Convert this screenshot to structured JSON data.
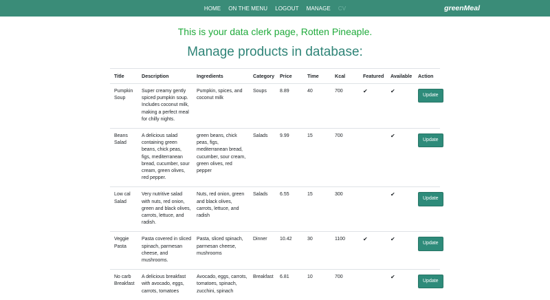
{
  "nav": {
    "items": [
      "HOME",
      "ON THE MENU",
      "LOGOUT",
      "MANAGE",
      "CV"
    ],
    "brand": "greenMeal"
  },
  "greeting": "This is your data clerk page, Rotten Pineaple.",
  "heading": "Manage products in database:",
  "table": {
    "columns": [
      "Title",
      "Description",
      "Ingredients",
      "Category",
      "Price",
      "Time",
      "Kcal",
      "Featured",
      "Available",
      "Action"
    ],
    "rows": [
      {
        "title": "Pumpkin Soup",
        "description": "Super creamy gently spiced pumpkin soup. Includes coconut milk, making a perfect meal for chilly nights.",
        "ingredients": "Pumpkin, spices, and coconut milk",
        "category": "Soups",
        "price": "8.89",
        "time": "40",
        "kcal": "700",
        "featured": "✔",
        "available": "✔",
        "action": "Update"
      },
      {
        "title": "Beans Salad",
        "description": "A delicious salad containing green beans, chick peas, figs, mediterranean bread, cucumber, sour cream, green olives, red pepper.",
        "ingredients": "green beans, chick peas, figs, mediterranean bread, cucumber, sour cream, green olives, red pepper",
        "category": "Salads",
        "price": "9.99",
        "time": "15",
        "kcal": "700",
        "featured": "",
        "available": "✔",
        "action": "Update"
      },
      {
        "title": "Low cal Salad",
        "description": "Very nutritive salad with nuts, red onion, green and black olives, carrots, lettuce, and radish.",
        "ingredients": "Nuts, red onion, green and black olives, carrots, lettuce, and radish",
        "category": "Salads",
        "price": "6.55",
        "time": "15",
        "kcal": "300",
        "featured": "",
        "available": "✔",
        "action": "Update"
      },
      {
        "title": "Veggie Pasta",
        "description": "Pasta covered in sliced spinach, parmesan cheese, and mushrooms.",
        "ingredients": "Pasta, sliced spinach, parmesan cheese, mushrooms",
        "category": "Dinner",
        "price": "10.42",
        "time": "30",
        "kcal": "1100",
        "featured": "✔",
        "available": "✔",
        "action": "Update"
      },
      {
        "title": "No carb Breakfast",
        "description": "A delicious breakfast with avocado, eggs, carrots, tomatoes",
        "ingredients": "Avocado, eggs, carrots, tomatoes, spinach, zucchini, spinach",
        "category": "Breakfast",
        "price": "6.81",
        "time": "10",
        "kcal": "700",
        "featured": "",
        "available": "✔",
        "action": "Update"
      }
    ]
  }
}
